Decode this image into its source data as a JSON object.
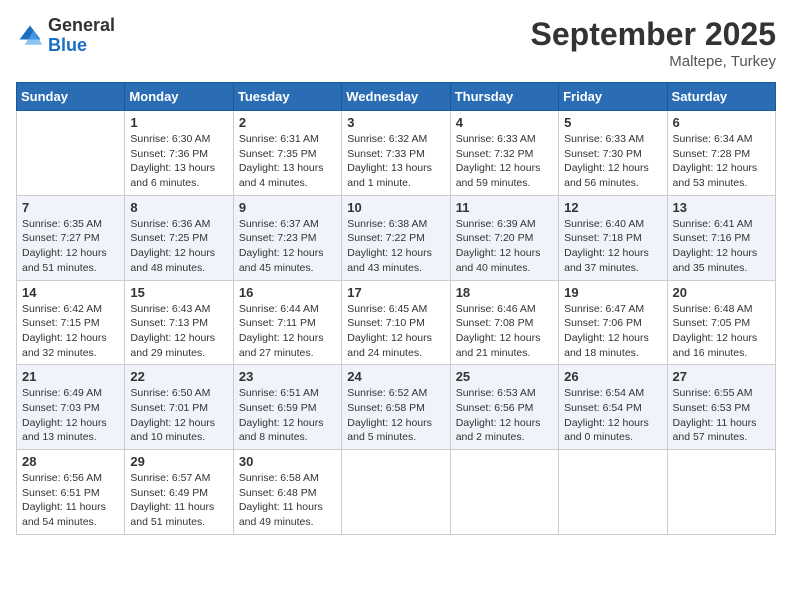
{
  "logo": {
    "general": "General",
    "blue": "Blue"
  },
  "title": "September 2025",
  "subtitle": "Maltepe, Turkey",
  "days_of_week": [
    "Sunday",
    "Monday",
    "Tuesday",
    "Wednesday",
    "Thursday",
    "Friday",
    "Saturday"
  ],
  "weeks": [
    [
      {
        "day": "",
        "sunrise": "",
        "sunset": "",
        "daylight": ""
      },
      {
        "day": "1",
        "sunrise": "Sunrise: 6:30 AM",
        "sunset": "Sunset: 7:36 PM",
        "daylight": "Daylight: 13 hours and 6 minutes."
      },
      {
        "day": "2",
        "sunrise": "Sunrise: 6:31 AM",
        "sunset": "Sunset: 7:35 PM",
        "daylight": "Daylight: 13 hours and 4 minutes."
      },
      {
        "day": "3",
        "sunrise": "Sunrise: 6:32 AM",
        "sunset": "Sunset: 7:33 PM",
        "daylight": "Daylight: 13 hours and 1 minute."
      },
      {
        "day": "4",
        "sunrise": "Sunrise: 6:33 AM",
        "sunset": "Sunset: 7:32 PM",
        "daylight": "Daylight: 12 hours and 59 minutes."
      },
      {
        "day": "5",
        "sunrise": "Sunrise: 6:33 AM",
        "sunset": "Sunset: 7:30 PM",
        "daylight": "Daylight: 12 hours and 56 minutes."
      },
      {
        "day": "6",
        "sunrise": "Sunrise: 6:34 AM",
        "sunset": "Sunset: 7:28 PM",
        "daylight": "Daylight: 12 hours and 53 minutes."
      }
    ],
    [
      {
        "day": "7",
        "sunrise": "Sunrise: 6:35 AM",
        "sunset": "Sunset: 7:27 PM",
        "daylight": "Daylight: 12 hours and 51 minutes."
      },
      {
        "day": "8",
        "sunrise": "Sunrise: 6:36 AM",
        "sunset": "Sunset: 7:25 PM",
        "daylight": "Daylight: 12 hours and 48 minutes."
      },
      {
        "day": "9",
        "sunrise": "Sunrise: 6:37 AM",
        "sunset": "Sunset: 7:23 PM",
        "daylight": "Daylight: 12 hours and 45 minutes."
      },
      {
        "day": "10",
        "sunrise": "Sunrise: 6:38 AM",
        "sunset": "Sunset: 7:22 PM",
        "daylight": "Daylight: 12 hours and 43 minutes."
      },
      {
        "day": "11",
        "sunrise": "Sunrise: 6:39 AM",
        "sunset": "Sunset: 7:20 PM",
        "daylight": "Daylight: 12 hours and 40 minutes."
      },
      {
        "day": "12",
        "sunrise": "Sunrise: 6:40 AM",
        "sunset": "Sunset: 7:18 PM",
        "daylight": "Daylight: 12 hours and 37 minutes."
      },
      {
        "day": "13",
        "sunrise": "Sunrise: 6:41 AM",
        "sunset": "Sunset: 7:16 PM",
        "daylight": "Daylight: 12 hours and 35 minutes."
      }
    ],
    [
      {
        "day": "14",
        "sunrise": "Sunrise: 6:42 AM",
        "sunset": "Sunset: 7:15 PM",
        "daylight": "Daylight: 12 hours and 32 minutes."
      },
      {
        "day": "15",
        "sunrise": "Sunrise: 6:43 AM",
        "sunset": "Sunset: 7:13 PM",
        "daylight": "Daylight: 12 hours and 29 minutes."
      },
      {
        "day": "16",
        "sunrise": "Sunrise: 6:44 AM",
        "sunset": "Sunset: 7:11 PM",
        "daylight": "Daylight: 12 hours and 27 minutes."
      },
      {
        "day": "17",
        "sunrise": "Sunrise: 6:45 AM",
        "sunset": "Sunset: 7:10 PM",
        "daylight": "Daylight: 12 hours and 24 minutes."
      },
      {
        "day": "18",
        "sunrise": "Sunrise: 6:46 AM",
        "sunset": "Sunset: 7:08 PM",
        "daylight": "Daylight: 12 hours and 21 minutes."
      },
      {
        "day": "19",
        "sunrise": "Sunrise: 6:47 AM",
        "sunset": "Sunset: 7:06 PM",
        "daylight": "Daylight: 12 hours and 18 minutes."
      },
      {
        "day": "20",
        "sunrise": "Sunrise: 6:48 AM",
        "sunset": "Sunset: 7:05 PM",
        "daylight": "Daylight: 12 hours and 16 minutes."
      }
    ],
    [
      {
        "day": "21",
        "sunrise": "Sunrise: 6:49 AM",
        "sunset": "Sunset: 7:03 PM",
        "daylight": "Daylight: 12 hours and 13 minutes."
      },
      {
        "day": "22",
        "sunrise": "Sunrise: 6:50 AM",
        "sunset": "Sunset: 7:01 PM",
        "daylight": "Daylight: 12 hours and 10 minutes."
      },
      {
        "day": "23",
        "sunrise": "Sunrise: 6:51 AM",
        "sunset": "Sunset: 6:59 PM",
        "daylight": "Daylight: 12 hours and 8 minutes."
      },
      {
        "day": "24",
        "sunrise": "Sunrise: 6:52 AM",
        "sunset": "Sunset: 6:58 PM",
        "daylight": "Daylight: 12 hours and 5 minutes."
      },
      {
        "day": "25",
        "sunrise": "Sunrise: 6:53 AM",
        "sunset": "Sunset: 6:56 PM",
        "daylight": "Daylight: 12 hours and 2 minutes."
      },
      {
        "day": "26",
        "sunrise": "Sunrise: 6:54 AM",
        "sunset": "Sunset: 6:54 PM",
        "daylight": "Daylight: 12 hours and 0 minutes."
      },
      {
        "day": "27",
        "sunrise": "Sunrise: 6:55 AM",
        "sunset": "Sunset: 6:53 PM",
        "daylight": "Daylight: 11 hours and 57 minutes."
      }
    ],
    [
      {
        "day": "28",
        "sunrise": "Sunrise: 6:56 AM",
        "sunset": "Sunset: 6:51 PM",
        "daylight": "Daylight: 11 hours and 54 minutes."
      },
      {
        "day": "29",
        "sunrise": "Sunrise: 6:57 AM",
        "sunset": "Sunset: 6:49 PM",
        "daylight": "Daylight: 11 hours and 51 minutes."
      },
      {
        "day": "30",
        "sunrise": "Sunrise: 6:58 AM",
        "sunset": "Sunset: 6:48 PM",
        "daylight": "Daylight: 11 hours and 49 minutes."
      },
      {
        "day": "",
        "sunrise": "",
        "sunset": "",
        "daylight": ""
      },
      {
        "day": "",
        "sunrise": "",
        "sunset": "",
        "daylight": ""
      },
      {
        "day": "",
        "sunrise": "",
        "sunset": "",
        "daylight": ""
      },
      {
        "day": "",
        "sunrise": "",
        "sunset": "",
        "daylight": ""
      }
    ]
  ]
}
